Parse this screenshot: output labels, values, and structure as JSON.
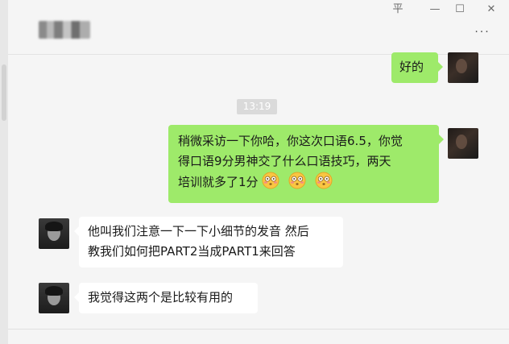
{
  "window": {
    "pin_glyph": "平",
    "minimize_glyph": "—",
    "maximize_glyph": "☐",
    "close_glyph": "✕",
    "more_glyph": "···"
  },
  "chat": {
    "messages": [
      {
        "sender": "self",
        "text": "好的"
      },
      {
        "type": "timestamp",
        "text": "13:19"
      },
      {
        "sender": "self",
        "text": "稍微采访一下你哈，你这次口语6.5，你觉得口语9分男神交了什么口语技巧，两天培训就多了1分",
        "line1": "稍微采访一下你哈，你这次口语6.5，你觉",
        "line2": "得口语9分男神交了什么口语技巧，两天",
        "line3": "培训就多了1分",
        "emoji_count": 3
      },
      {
        "sender": "other",
        "text": "他叫我们注意一下一下小细节的发音 然后教我们如何把PART2当成PART1来回答",
        "line1": "他叫我们注意一下一下小细节的发音 然后",
        "line2": "教我们如何把PART2当成PART1来回答"
      },
      {
        "sender": "other",
        "text": "我觉得这两个是比较有用的"
      }
    ]
  },
  "colors": {
    "self_bubble": "#9eea6a",
    "other_bubble": "#ffffff",
    "background": "#f5f5f5",
    "timestamp_bg": "#dadada"
  },
  "icons": [
    "flushed-face-emoji",
    "pin-icon",
    "minimize-icon",
    "maximize-icon",
    "close-icon",
    "more-icon"
  ]
}
